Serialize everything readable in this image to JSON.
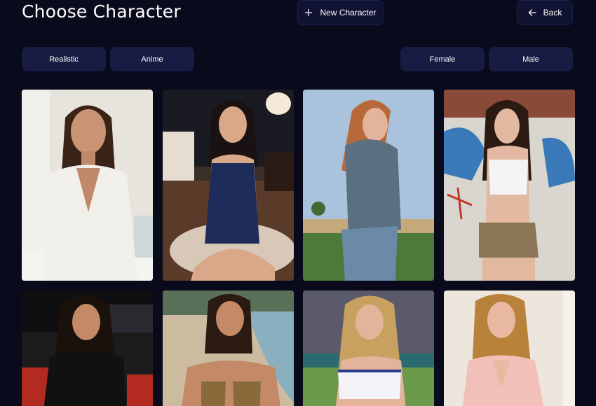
{
  "header": {
    "title": "Choose Character",
    "new_character_label": "New Character",
    "back_label": "Back"
  },
  "filters": {
    "style": [
      "Realistic",
      "Anime"
    ],
    "gender": [
      "Female",
      "Male"
    ]
  },
  "characters": [
    {
      "icon": "character-portrait",
      "scene": "bathroom, white robe"
    },
    {
      "icon": "character-portrait",
      "scene": "living room, blue dress"
    },
    {
      "icon": "character-portrait",
      "scene": "field, denim outfit"
    },
    {
      "icon": "character-portrait",
      "scene": "graffiti wall, white top"
    },
    {
      "icon": "character-portrait",
      "scene": "theater, black top"
    },
    {
      "icon": "character-portrait",
      "scene": "beach, swimwear"
    },
    {
      "icon": "character-portrait",
      "scene": "stadium, sports top"
    },
    {
      "icon": "character-portrait",
      "scene": "bedroom, pink shirt"
    }
  ],
  "colors": {
    "background": "#090a1c",
    "button_bg": "#0f1231",
    "filter_bg": "#181c42"
  }
}
